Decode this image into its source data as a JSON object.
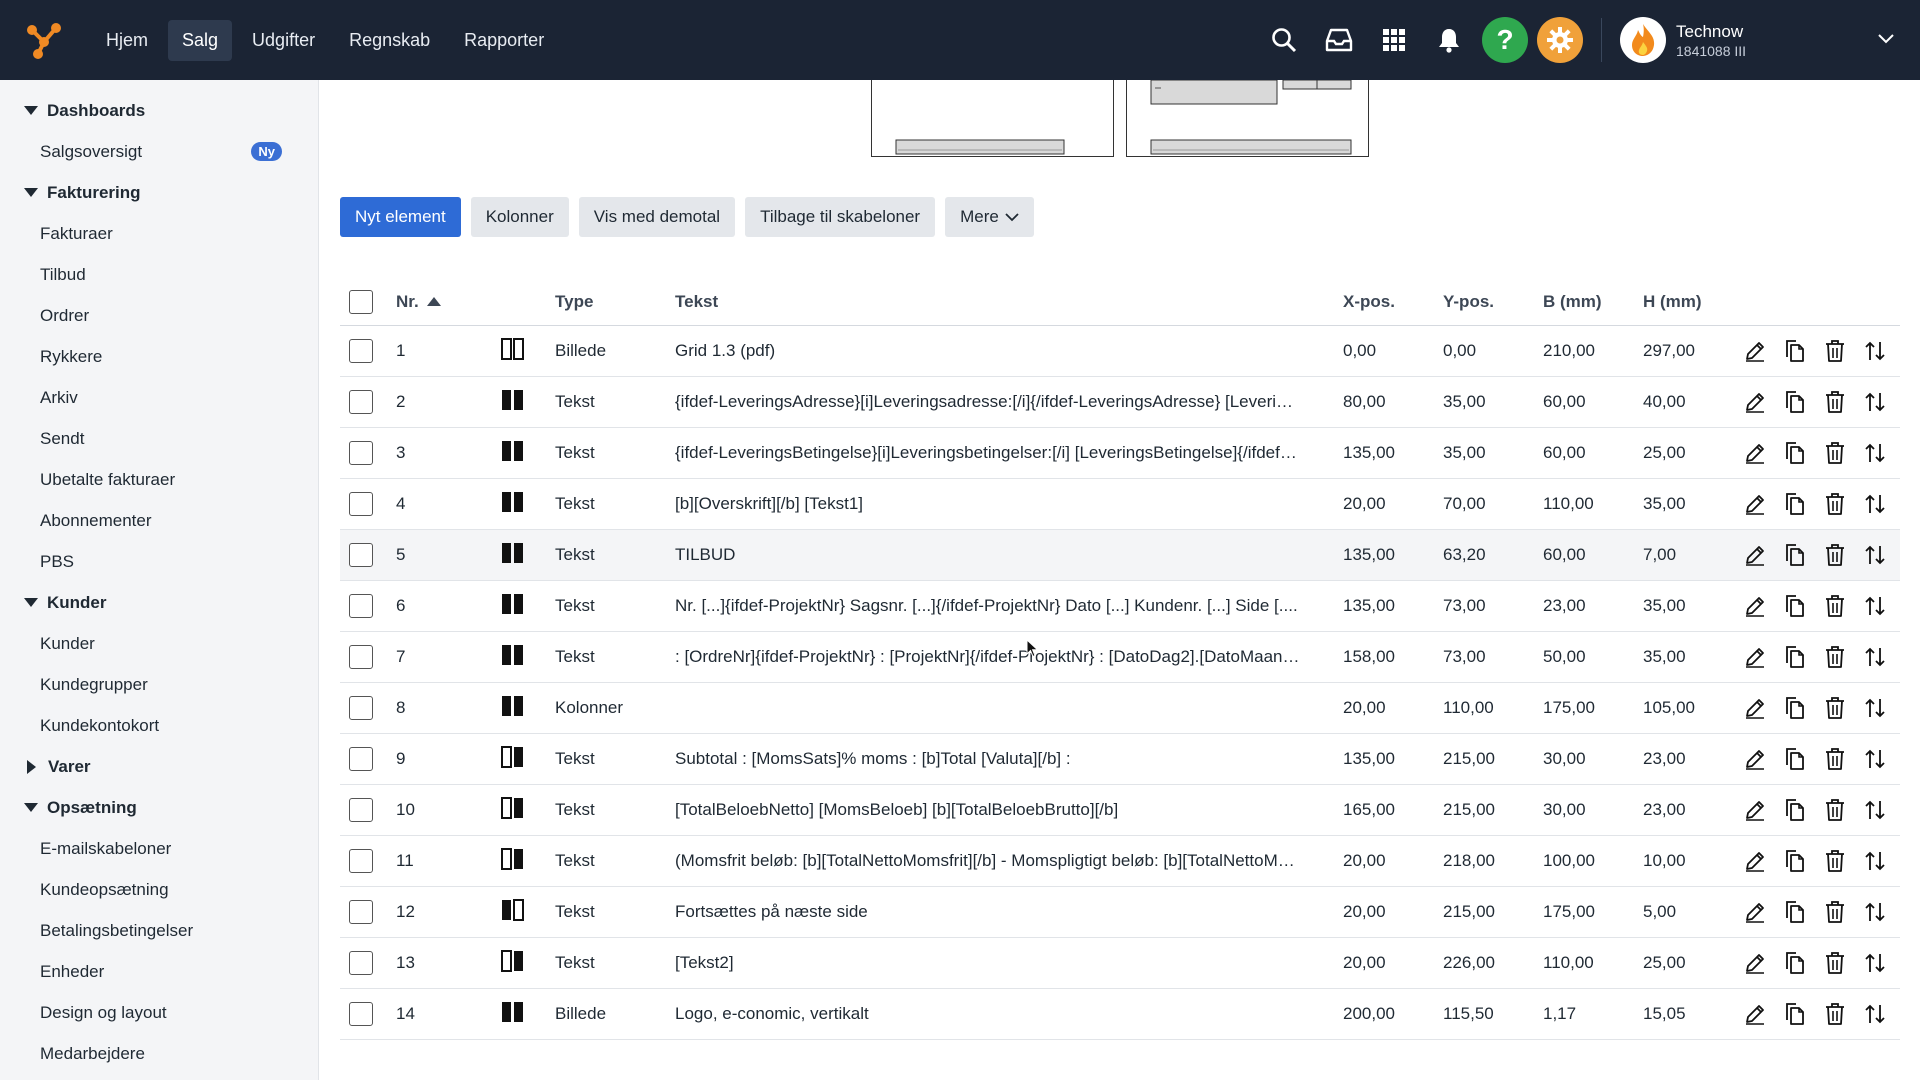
{
  "nav": {
    "items": [
      "Hjem",
      "Salg",
      "Udgifter",
      "Regnskab",
      "Rapporter"
    ],
    "active_index": 1
  },
  "topbar": {
    "icons": [
      "search-icon",
      "inbox-icon",
      "apps-grid-icon",
      "bell-icon",
      "help-icon",
      "gear-icon"
    ],
    "help_glyph": "?",
    "company": "Technow",
    "company_id": "1841088 III"
  },
  "sidebar": {
    "dashboards": {
      "label": "Dashboards",
      "items": [
        {
          "label": "Salgsoversigt",
          "badge": "Ny"
        }
      ]
    },
    "fakturering": {
      "label": "Fakturering",
      "items": [
        "Fakturaer",
        "Tilbud",
        "Ordrer",
        "Rykkere",
        "Arkiv",
        "Sendt",
        "Ubetalte fakturaer",
        "Abonnementer",
        "PBS"
      ]
    },
    "kunder": {
      "label": "Kunder",
      "items": [
        "Kunder",
        "Kundegrupper",
        "Kundekontokort"
      ]
    },
    "varer": {
      "label": "Varer"
    },
    "opsaetning": {
      "label": "Opsætning",
      "items": [
        "E-mailskabeloner",
        "Kundeopsætning",
        "Betalingsbetingelser",
        "Enheder",
        "Design og layout",
        "Medarbejdere"
      ]
    }
  },
  "toolbar": {
    "new_element": "Nyt element",
    "columns": "Kolonner",
    "show_demo": "Vis med demotal",
    "back_templates": "Tilbage til skabeloner",
    "more": "Mere"
  },
  "table": {
    "headers": {
      "nr": "Nr.",
      "type": "Type",
      "text": "Tekst",
      "x": "X-pos.",
      "y": "Y-pos.",
      "b": "B (mm)",
      "h": "H (mm)"
    },
    "rows": [
      {
        "nr": "1",
        "icon": "outline",
        "type": "Billede",
        "text": "Grid 1.3 (pdf)",
        "x": "0,00",
        "y": "0,00",
        "b": "210,00",
        "h": "297,00"
      },
      {
        "nr": "2",
        "icon": "filled",
        "type": "Tekst",
        "text": "{ifdef-LeveringsAdresse}[i]Leveringsadresse:[/i]{/ifdef-LeveringsAdresse} [Leveri…",
        "x": "80,00",
        "y": "35,00",
        "b": "60,00",
        "h": "40,00"
      },
      {
        "nr": "3",
        "icon": "filled",
        "type": "Tekst",
        "text": "{ifdef-LeveringsBetingelse}[i]Leveringsbetingelser:[/i] [LeveringsBetingelse]{/ifdef…",
        "x": "135,00",
        "y": "35,00",
        "b": "60,00",
        "h": "25,00"
      },
      {
        "nr": "4",
        "icon": "filled",
        "type": "Tekst",
        "text": "[b][Overskrift][/b] [Tekst1]",
        "x": "20,00",
        "y": "70,00",
        "b": "110,00",
        "h": "35,00"
      },
      {
        "nr": "5",
        "icon": "filled",
        "type": "Tekst",
        "text": "TILBUD",
        "x": "135,00",
        "y": "63,20",
        "b": "60,00",
        "h": "7,00"
      },
      {
        "nr": "6",
        "icon": "filled",
        "type": "Tekst",
        "text": "Nr. [...]{ifdef-ProjektNr} Sagsnr. [...]{/ifdef-ProjektNr} Dato [...] Kundenr. [...] Side [....",
        "x": "135,00",
        "y": "73,00",
        "b": "23,00",
        "h": "35,00"
      },
      {
        "nr": "7",
        "icon": "filled",
        "type": "Tekst",
        "text": ": [OrdreNr]{ifdef-ProjektNr} : [ProjektNr]{/ifdef-ProjektNr} : [DatoDag2].[DatoMaan…",
        "x": "158,00",
        "y": "73,00",
        "b": "50,00",
        "h": "35,00"
      },
      {
        "nr": "8",
        "icon": "filled",
        "type": "Kolonner",
        "text": "",
        "x": "20,00",
        "y": "110,00",
        "b": "175,00",
        "h": "105,00"
      },
      {
        "nr": "9",
        "icon": "half",
        "type": "Tekst",
        "text": "Subtotal : [MomsSats]% moms : [b]Total [Valuta][/b] :",
        "x": "135,00",
        "y": "215,00",
        "b": "30,00",
        "h": "23,00"
      },
      {
        "nr": "10",
        "icon": "half",
        "type": "Tekst",
        "text": "[TotalBeloebNetto] [MomsBeloeb] [b][TotalBeloebBrutto][/b]",
        "x": "165,00",
        "y": "215,00",
        "b": "30,00",
        "h": "23,00"
      },
      {
        "nr": "11",
        "icon": "half",
        "type": "Tekst",
        "text": "(Momsfrit beløb: [b][TotalNettoMomsfrit][/b] - Momspligtigt beløb: [b][TotalNettoM…",
        "x": "20,00",
        "y": "218,00",
        "b": "100,00",
        "h": "10,00"
      },
      {
        "nr": "12",
        "icon": "half-left",
        "type": "Tekst",
        "text": "Fortsættes på næste side",
        "x": "20,00",
        "y": "215,00",
        "b": "175,00",
        "h": "5,00"
      },
      {
        "nr": "13",
        "icon": "half",
        "type": "Tekst",
        "text": "[Tekst2]",
        "x": "20,00",
        "y": "226,00",
        "b": "110,00",
        "h": "25,00"
      },
      {
        "nr": "14",
        "icon": "filled",
        "type": "Billede",
        "text": "Logo, e-conomic, vertikalt",
        "x": "200,00",
        "y": "115,50",
        "b": "1,17",
        "h": "15,05"
      }
    ],
    "hover_row": 5,
    "row_actions": [
      "edit-icon",
      "copy-icon",
      "delete-icon",
      "move-icon"
    ]
  },
  "colors": {
    "topbar": "#1b2434",
    "primary": "#2e6bd6",
    "help": "#2fa84f",
    "settings": "#f0a13a",
    "badge": "#3b6fd4"
  }
}
